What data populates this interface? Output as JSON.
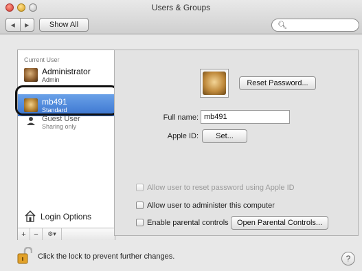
{
  "window": {
    "title": "Users & Groups"
  },
  "toolbar": {
    "back_icon": "chevron-left-icon",
    "forward_icon": "chevron-right-icon",
    "show_all_label": "Show All",
    "search_placeholder": ""
  },
  "sidebar": {
    "section_header": "Current User",
    "users": [
      {
        "name": "Administrator",
        "role": "Admin",
        "selected": false
      },
      {
        "name": "mb491",
        "role": "Standard",
        "selected": true
      },
      {
        "name": "Guest User",
        "role": "Sharing only",
        "selected": false
      }
    ],
    "login_options_label": "Login Options",
    "tools": {
      "add": "+",
      "remove": "−",
      "action": "⚙▾"
    }
  },
  "detail": {
    "reset_password_label": "Reset Password...",
    "full_name_label": "Full name:",
    "full_name_value": "mb491",
    "apple_id_label": "Apple ID:",
    "set_label": "Set...",
    "allow_reset_label": "Allow user to reset password using Apple ID",
    "allow_admin_label": "Allow user to administer this computer",
    "parental_label": "Enable parental controls",
    "open_parental_label": "Open Parental Controls..."
  },
  "footer": {
    "lock_text": "Click the lock to prevent further changes.",
    "help_label": "?"
  },
  "colors": {
    "selection": "#3a74cf",
    "highlight_ring": "#111111"
  }
}
